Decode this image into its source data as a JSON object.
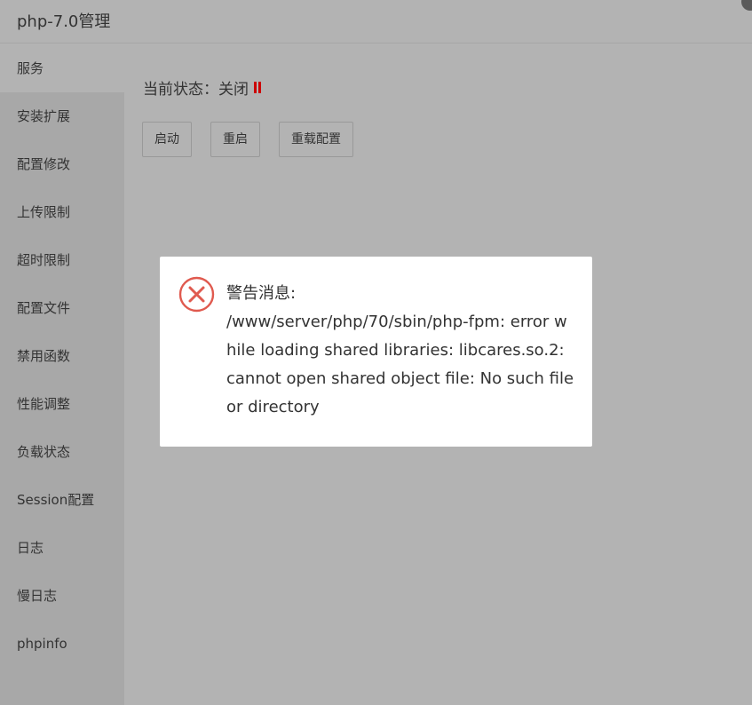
{
  "window": {
    "title": "php-7.0管理"
  },
  "sidebar": {
    "items": [
      {
        "label": "服务"
      },
      {
        "label": "安装扩展"
      },
      {
        "label": "配置修改"
      },
      {
        "label": "上传限制"
      },
      {
        "label": "超时限制"
      },
      {
        "label": "配置文件"
      },
      {
        "label": "禁用函数"
      },
      {
        "label": "性能调整"
      },
      {
        "label": "负载状态"
      },
      {
        "label": "Session配置"
      },
      {
        "label": "日志"
      },
      {
        "label": "慢日志"
      },
      {
        "label": "phpinfo"
      }
    ],
    "active_index": 0
  },
  "service": {
    "status_label": "当前状态：关闭",
    "status_icon": "pause-icon",
    "status_color": "#cc0000",
    "buttons": {
      "start": "启动",
      "restart": "重启",
      "reload": "重载配置"
    }
  },
  "dialog": {
    "icon": "error-icon",
    "icon_color": "#e05a4f",
    "title": "警告消息:",
    "message": "/www/server/php/70/sbin/php-fpm: error while loading shared libraries: libcares.so.2: cannot open shared object file: No such file or directory"
  }
}
